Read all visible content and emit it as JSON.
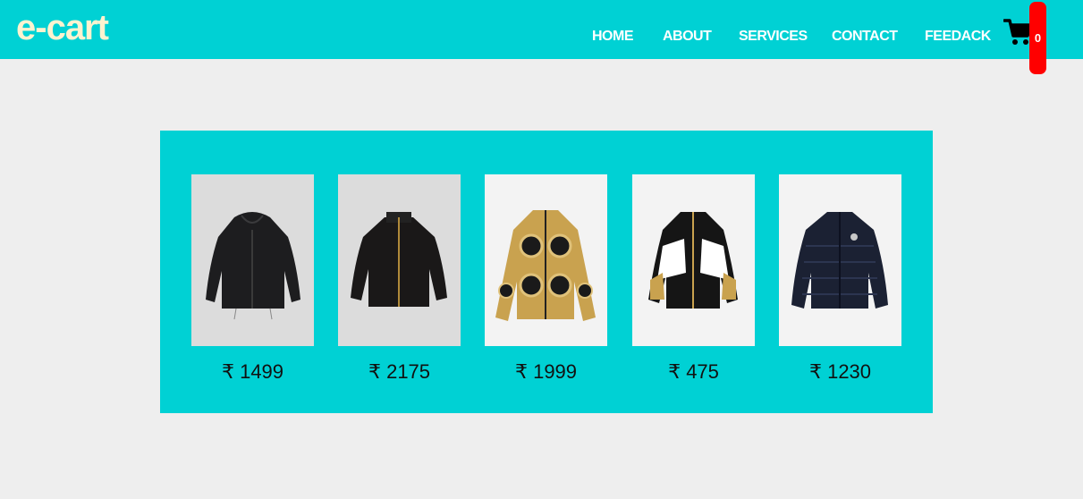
{
  "header": {
    "logo": "e-cart",
    "nav": [
      "HOME",
      "ABOUT",
      "SERVICES",
      "CONTACT",
      "FEEDACK"
    ],
    "cart_count": "0",
    "cart_icon": "shopping-cart-icon"
  },
  "products": [
    {
      "price": "₹ 1499",
      "image": "black-hooded-jacket"
    },
    {
      "price": "₹ 2175",
      "image": "black-zip-jacket"
    },
    {
      "price": "₹ 1999",
      "image": "gold-baroque-print-jacket"
    },
    {
      "price": "₹ 475",
      "image": "black-white-gold-track-jacket"
    },
    {
      "price": "₹ 1230",
      "image": "navy-puffer-jacket"
    }
  ],
  "colors": {
    "accent": "#00d1d4",
    "background": "#eeeeee",
    "badge": "#ff0000",
    "logo": "#fdf3cf"
  }
}
